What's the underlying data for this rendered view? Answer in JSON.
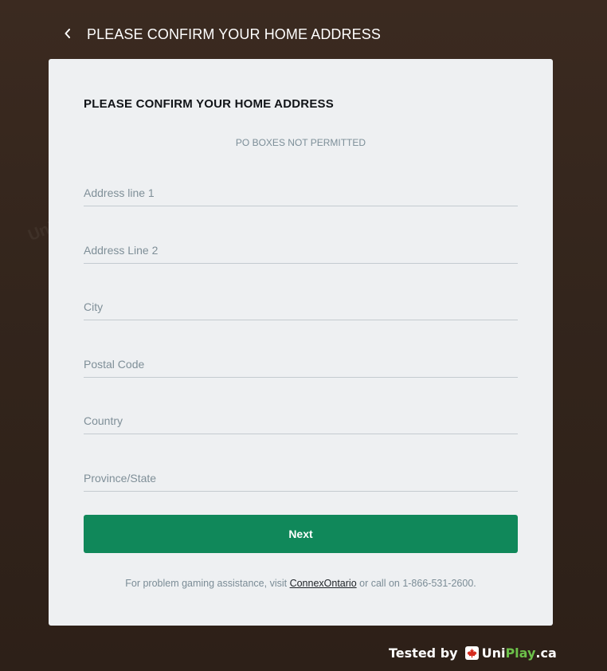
{
  "header": {
    "title": "PLEASE CONFIRM YOUR HOME ADDRESS"
  },
  "card": {
    "title": "PLEASE CONFIRM YOUR HOME ADDRESS",
    "notice": "PO BOXES NOT PERMITTED"
  },
  "fields": {
    "address1": {
      "placeholder": "Address line 1",
      "value": ""
    },
    "address2": {
      "placeholder": "Address Line 2",
      "value": ""
    },
    "city": {
      "placeholder": "City",
      "value": ""
    },
    "postal": {
      "placeholder": "Postal Code",
      "value": ""
    },
    "country": {
      "placeholder": "Country",
      "value": ""
    },
    "province": {
      "placeholder": "Province/State",
      "value": ""
    }
  },
  "next_label": "Next",
  "footer": {
    "prefix": "For problem gaming assistance, visit ",
    "link": "ConnexOntario",
    "suffix": " or call on 1-866-531-2600."
  },
  "badge": {
    "tested": "Tested by",
    "uni": "Uni",
    "play": "Play",
    "ca": ".ca"
  },
  "colors": {
    "background": "#33251c",
    "card": "#eef0f2",
    "accent": "#10885a",
    "brand_green": "#6cc04a",
    "maple_red": "#d52b1e"
  },
  "icons": {
    "back": "chevron-left-icon",
    "maple": "maple-leaf-icon"
  }
}
